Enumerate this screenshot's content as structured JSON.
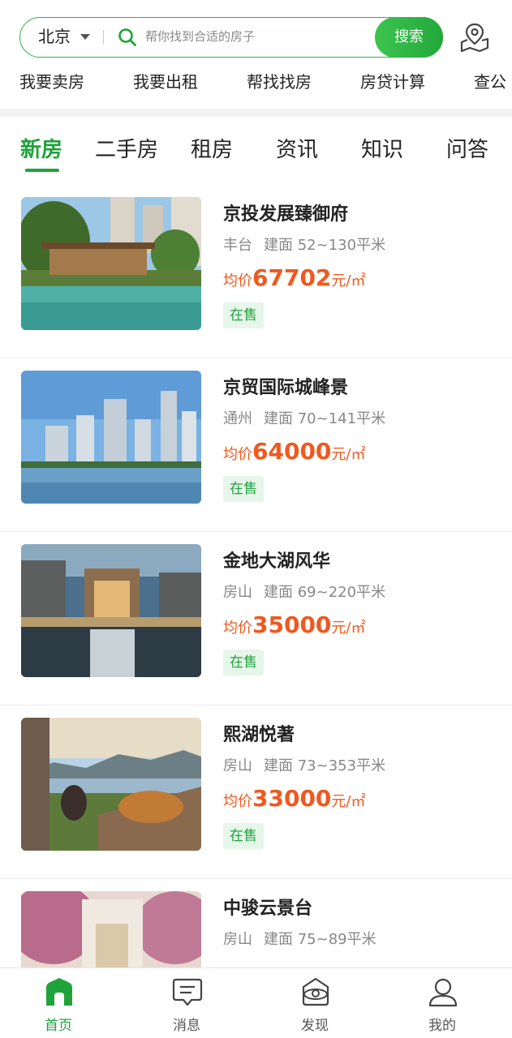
{
  "search": {
    "city": "北京",
    "placeholder": "帮你找到合适的房子",
    "button": "搜索"
  },
  "quick_links": [
    "我要卖房",
    "我要出租",
    "帮找找房",
    "房贷计算",
    "查公"
  ],
  "tabs": [
    {
      "label": "新房",
      "active": true
    },
    {
      "label": "二手房",
      "active": false
    },
    {
      "label": "租房",
      "active": false
    },
    {
      "label": "资讯",
      "active": false
    },
    {
      "label": "知识",
      "active": false
    },
    {
      "label": "问答",
      "active": false
    }
  ],
  "listings": [
    {
      "name": "京投发展臻御府",
      "district": "丰台",
      "area": "建面 52~130平米",
      "price_prefix": "均价",
      "price": "67702",
      "price_unit": "元/㎡",
      "status": "在售"
    },
    {
      "name": "京贸国际城峰景",
      "district": "通州",
      "area": "建面 70~141平米",
      "price_prefix": "均价",
      "price": "64000",
      "price_unit": "元/㎡",
      "status": "在售"
    },
    {
      "name": "金地大湖风华",
      "district": "房山",
      "area": "建面 69~220平米",
      "price_prefix": "均价",
      "price": "35000",
      "price_unit": "元/㎡",
      "status": "在售"
    },
    {
      "name": "熙湖悦著",
      "district": "房山",
      "area": "建面 73~353平米",
      "price_prefix": "均价",
      "price": "33000",
      "price_unit": "元/㎡",
      "status": "在售"
    },
    {
      "name": "中骏云景台",
      "district": "房山",
      "area": "建面 75~89平米",
      "price_prefix": "",
      "price": "",
      "price_unit": "",
      "status": ""
    }
  ],
  "bottom_nav": [
    {
      "label": "首页",
      "icon": "home-icon",
      "active": true
    },
    {
      "label": "消息",
      "icon": "message-icon",
      "active": false
    },
    {
      "label": "发现",
      "icon": "discover-icon",
      "active": false
    },
    {
      "label": "我的",
      "icon": "profile-icon",
      "active": false
    }
  ],
  "colors": {
    "accent": "#1fa23a",
    "price": "#f0581e",
    "status_bg": "#e6f6ea"
  }
}
